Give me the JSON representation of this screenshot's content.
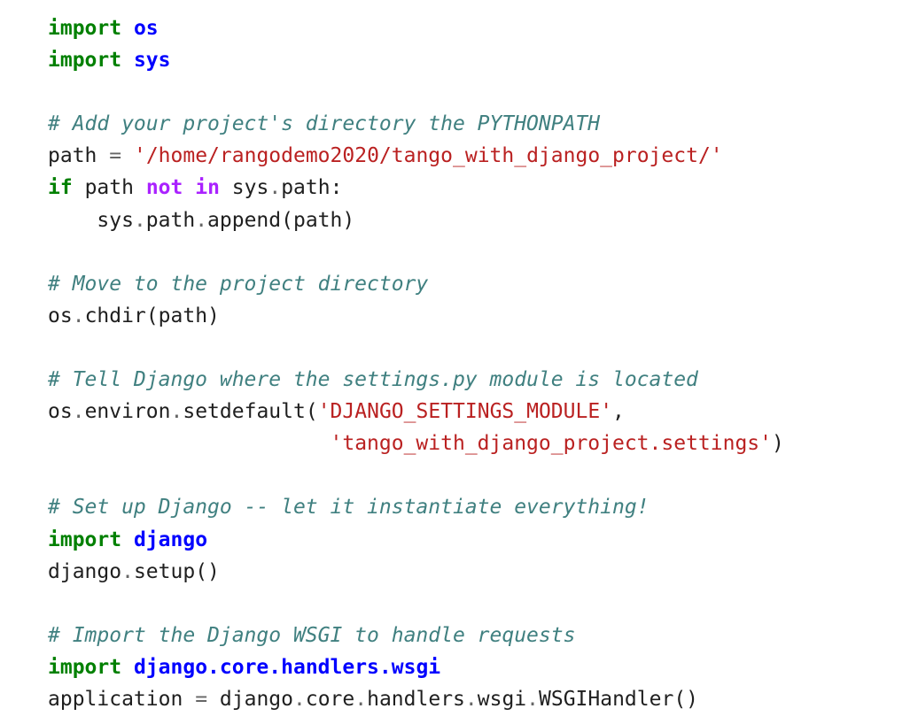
{
  "code": {
    "l1": {
      "kw": "import",
      "mod": "os"
    },
    "l2": {
      "kw": "import",
      "mod": "sys"
    },
    "l4": {
      "comment": "# Add your project's directory the PYTHONPATH"
    },
    "l5": {
      "var": "path",
      "eq": "=",
      "str": "'/home/rangodemo2020/tango_with_django_project/'"
    },
    "l6": {
      "kw_if": "if",
      "var": "path",
      "kw_not": "not",
      "kw_in": "in",
      "obj": "sys",
      "dot": ".",
      "attr": "path",
      "colon": ":"
    },
    "l7": {
      "indent": "    ",
      "obj": "sys",
      "dot1": ".",
      "attr": "path",
      "dot2": ".",
      "fn": "append",
      "args": "(path)"
    },
    "l9": {
      "comment": "# Move to the project directory"
    },
    "l10": {
      "obj": "os",
      "dot": ".",
      "fn": "chdir",
      "args": "(path)"
    },
    "l12": {
      "comment": "# Tell Django where the settings.py module is located"
    },
    "l13": {
      "obj": "os",
      "dot1": ".",
      "attr": "environ",
      "dot2": ".",
      "fn": "setdefault",
      "open": "(",
      "str": "'DJANGO_SETTINGS_MODULE'",
      "comma": ","
    },
    "l14": {
      "indent": "                       ",
      "str": "'tango_with_django_project.settings'",
      "close": ")"
    },
    "l16": {
      "comment": "# Set up Django -- let it instantiate everything!"
    },
    "l17": {
      "kw": "import",
      "mod": "django"
    },
    "l18": {
      "obj": "django",
      "dot": ".",
      "fn": "setup",
      "args": "()"
    },
    "l20": {
      "comment": "# Import the Django WSGI to handle requests"
    },
    "l21": {
      "kw": "import",
      "mod": "django.core.handlers.wsgi"
    },
    "l22": {
      "var": "application",
      "eq": "=",
      "obj": "django",
      "d1": ".",
      "a1": "core",
      "d2": ".",
      "a2": "handlers",
      "d3": ".",
      "a3": "wsgi",
      "d4": ".",
      "fn": "WSGIHandler",
      "args": "()"
    }
  }
}
